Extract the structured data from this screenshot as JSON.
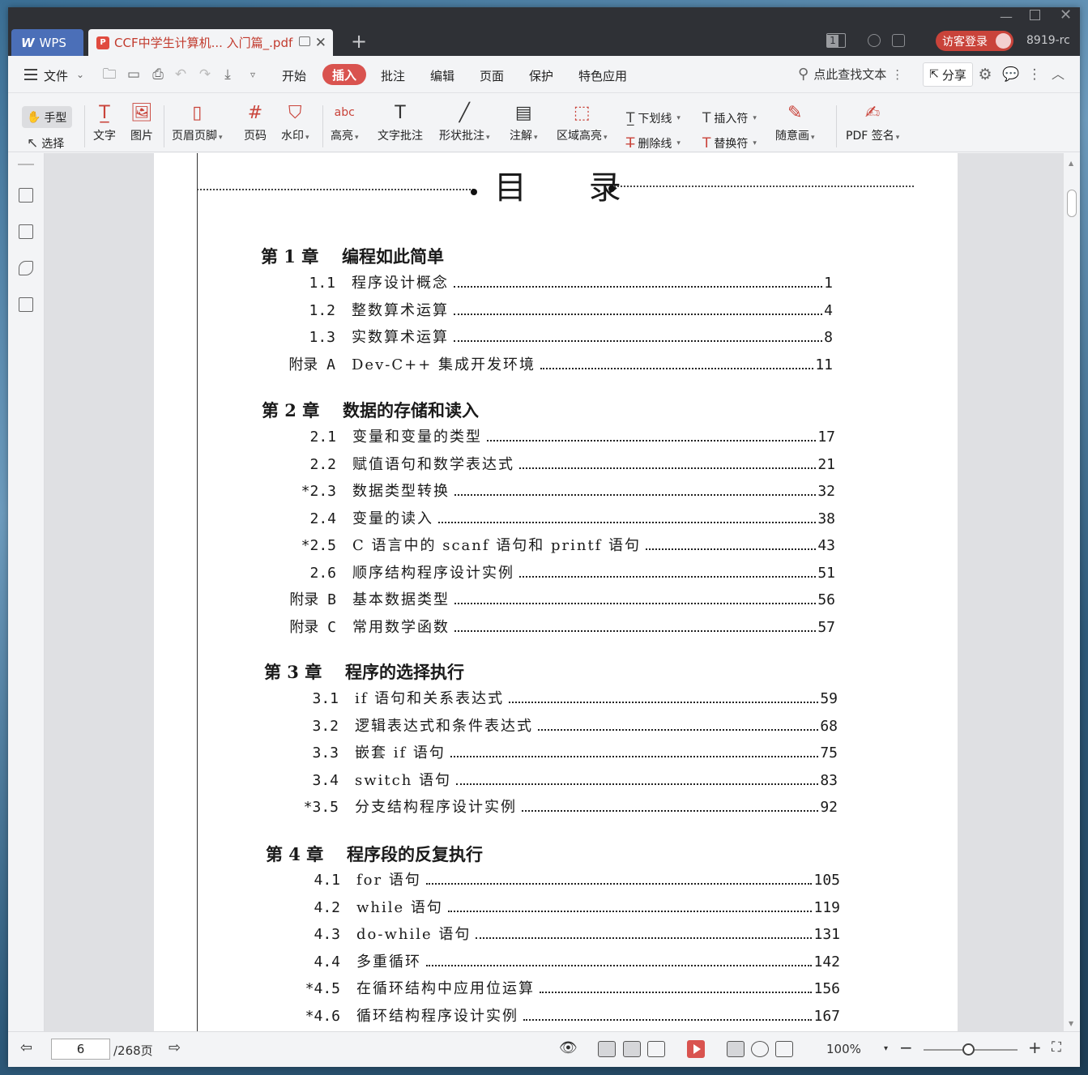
{
  "titlebar": {
    "wps_tab": "WPS",
    "doc_tab": "CCF中学生计算机... 入门篇_.pdf",
    "page_count_badge": "1",
    "visitor_login": "访客登录",
    "user_id": "8919-rc"
  },
  "menubar": {
    "file": "文件",
    "items": [
      "开始",
      "插入",
      "批注",
      "编辑",
      "页面",
      "保护",
      "特色应用"
    ],
    "active": "插入",
    "search": "点此查找文本",
    "share": "分享"
  },
  "toolbar": {
    "hand": "手型",
    "select": "选择",
    "text": "文字",
    "image": "图片",
    "header_footer": "页眉页脚",
    "page_number": "页码",
    "watermark": "水印",
    "highlight": "高亮",
    "text_comment": "文字批注",
    "shape_comment": "形状批注",
    "annotation": "注解",
    "area_highlight": "区域高亮",
    "underline": "下划线",
    "strikethrough": "删除线",
    "insert_mark": "插入符",
    "replace_mark": "替换符",
    "freehand": "随意画",
    "pdf_sign": "PDF 签名"
  },
  "toc": {
    "title": "目 录",
    "chapters": [
      {
        "label": "第 1 章",
        "title": "编程如此简单",
        "entries": [
          {
            "num": "1.1",
            "title": "程序设计概念",
            "page": "1"
          },
          {
            "num": "1.2",
            "title": "整数算术运算",
            "page": "4"
          },
          {
            "num": "1.3",
            "title": "实数算术运算",
            "page": "8"
          },
          {
            "num": "附录 A",
            "title": "Dev-C++ 集成开发环境",
            "page": "11"
          }
        ]
      },
      {
        "label": "第 2 章",
        "title": "数据的存储和读入",
        "entries": [
          {
            "num": "2.1",
            "title": "变量和变量的类型",
            "page": "17"
          },
          {
            "num": "2.2",
            "title": "赋值语句和数学表达式",
            "page": "21"
          },
          {
            "num": "*2.3",
            "title": "数据类型转换",
            "page": "32"
          },
          {
            "num": "2.4",
            "title": "变量的读入",
            "page": "38"
          },
          {
            "num": "*2.5",
            "title": "C 语言中的 scanf 语句和 printf 语句",
            "page": "43"
          },
          {
            "num": "2.6",
            "title": "顺序结构程序设计实例",
            "page": "51"
          },
          {
            "num": "附录 B",
            "title": "基本数据类型",
            "page": "56"
          },
          {
            "num": "附录 C",
            "title": "常用数学函数",
            "page": "57"
          }
        ]
      },
      {
        "label": "第 3 章",
        "title": "程序的选择执行",
        "entries": [
          {
            "num": "3.1",
            "title": "if 语句和关系表达式",
            "page": "59"
          },
          {
            "num": "3.2",
            "title": "逻辑表达式和条件表达式",
            "page": "68"
          },
          {
            "num": "3.3",
            "title": "嵌套 if 语句",
            "page": "75"
          },
          {
            "num": "3.4",
            "title": "switch 语句",
            "page": "83"
          },
          {
            "num": "*3.5",
            "title": "分支结构程序设计实例",
            "page": "92"
          }
        ]
      },
      {
        "label": "第 4 章",
        "title": "程序段的反复执行",
        "entries": [
          {
            "num": "4.1",
            "title": "for 语句",
            "page": "105"
          },
          {
            "num": "4.2",
            "title": "while 语句",
            "page": "119"
          },
          {
            "num": "4.3",
            "title": "do-while 语句",
            "page": "131"
          },
          {
            "num": "4.4",
            "title": "多重循环",
            "page": "142"
          },
          {
            "num": "*4.5",
            "title": "在循环结构中应用位运算",
            "page": "156"
          },
          {
            "num": "*4.6",
            "title": "循环结构程序设计实例",
            "page": "167"
          }
        ]
      }
    ]
  },
  "statusbar": {
    "current_page": "6",
    "total_pages": "/268页",
    "zoom": "100%"
  },
  "colors": {
    "accent": "#d9534f",
    "titlebar": "#2f3136",
    "wps_tab": "#4b6fb8"
  }
}
